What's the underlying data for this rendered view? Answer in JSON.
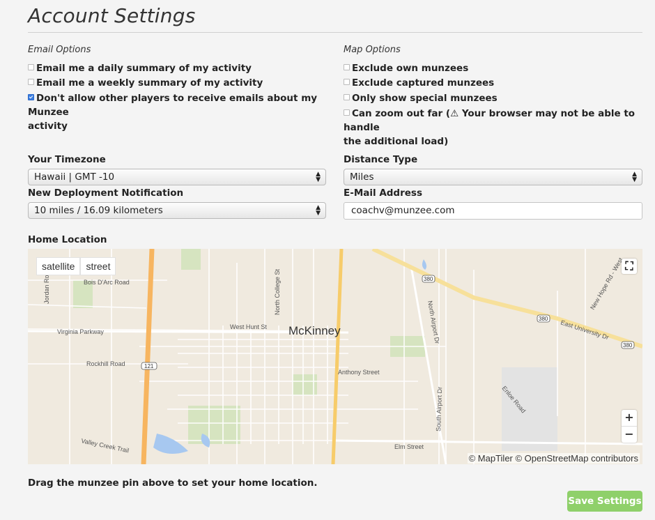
{
  "page": {
    "title": "Account Settings"
  },
  "email_options": {
    "heading": "Email Options",
    "items": [
      {
        "label": "Email me a daily summary of my activity",
        "checked": false
      },
      {
        "label": "Email me a weekly summary of my activity",
        "checked": false
      },
      {
        "label": "Don't allow other players to receive emails about my Munzee",
        "label_cont": "activity",
        "checked": true
      }
    ]
  },
  "map_options": {
    "heading": "Map Options",
    "items": [
      {
        "label": "Exclude own munzees",
        "checked": false
      },
      {
        "label": "Exclude captured munzees",
        "checked": false
      },
      {
        "label": "Only show special munzees",
        "checked": false
      },
      {
        "label": "Can zoom out far (",
        "label_warn": "Your browser may not be able to handle",
        "label_cont": "the additional load)",
        "checked": false
      }
    ]
  },
  "timezone": {
    "label": "Your Timezone",
    "value": "Hawaii | GMT -10"
  },
  "distance": {
    "label": "Distance Type",
    "value": "Miles"
  },
  "deployment": {
    "label": "New Deployment Notification",
    "value": "10 miles / 16.09 kilometers"
  },
  "email": {
    "label": "E-Mail Address",
    "value": "coachv@munzee.com"
  },
  "home": {
    "label": "Home Location",
    "map": {
      "mode_satellite": "satellite",
      "mode_street": "street",
      "city": "McKinney",
      "attribution": "© MapTiler © OpenStreetMap contributors",
      "zoom_in": "+",
      "zoom_out": "−",
      "fullscreen_icon": "expand-icon",
      "streets": [
        "Bois D'Arc Road",
        "Jordan Road",
        "Virginia Parkway",
        "Rockhill Road",
        "Valley Creek Trail",
        "West Hunt St",
        "North College St",
        "North Airport Dr",
        "Anthony Street",
        "South Airport Dr",
        "Elm Street",
        "Enloe Road",
        "East University Dr",
        "New Hope Rd - West"
      ],
      "shields": [
        "121",
        "380",
        "380",
        "380"
      ]
    },
    "hint": "Drag the munzee pin above to set your home location."
  },
  "save_button": "Save Settings",
  "colors": {
    "save": "#8fd06a",
    "checkbox_checked": "#3b7de0",
    "map_bg": "#f0eadf",
    "highway": "#f7b560"
  }
}
